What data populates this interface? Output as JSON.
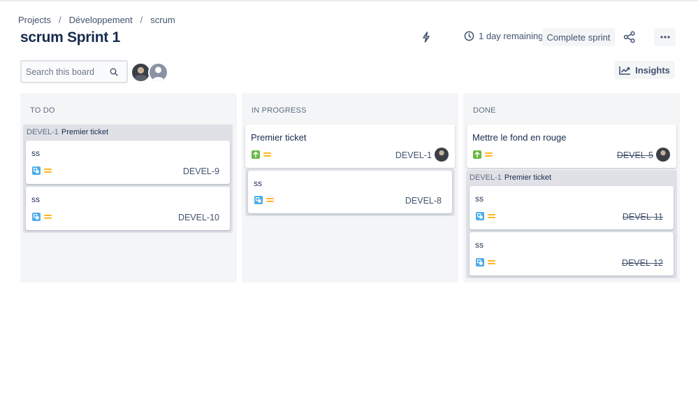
{
  "breadcrumb": {
    "items": [
      "Projects",
      "Développement",
      "scrum"
    ],
    "separator": "/"
  },
  "page": {
    "title": "scrum Sprint 1"
  },
  "header": {
    "remaining": "1 day remaining",
    "complete_label": "Complete sprint",
    "insights_label": "Insights"
  },
  "search": {
    "placeholder": "Search this board",
    "value": ""
  },
  "icons": {
    "automation": "lightning-bolt-icon",
    "clock": "clock-icon",
    "share": "share-icon",
    "more": "more-horizontal-icon",
    "search": "search-icon",
    "insights": "insights-chart-icon",
    "subtask": "subtask-icon",
    "story": "story-icon",
    "priority": "priority-medium-icon"
  },
  "colors": {
    "subtask": "#4bade8",
    "story": "#65ba43",
    "priority": "#ffab00",
    "column_bg": "#f4f5f7",
    "group_bg": "#dfe1e6"
  },
  "columns": {
    "todo": {
      "title": "TO DO",
      "group": {
        "key": "DEVEL-1",
        "summary": "Premier ticket",
        "cards": [
          {
            "title": "ss",
            "key": "DEVEL-9"
          },
          {
            "title": "ss",
            "key": "DEVEL-10"
          }
        ]
      }
    },
    "progress": {
      "title": "IN PROGRESS",
      "story": {
        "title": "Premier ticket",
        "key": "DEVEL-1"
      },
      "group": {
        "cards": [
          {
            "title": "ss",
            "key": "DEVEL-8"
          }
        ]
      }
    },
    "done": {
      "title": "DONE",
      "story": {
        "title": "Mettre le fond en rouge",
        "key": "DEVEL-5"
      },
      "group": {
        "key": "DEVEL-1",
        "summary": "Premier ticket",
        "cards": [
          {
            "title": "ss",
            "key": "DEVEL-11"
          },
          {
            "title": "ss",
            "key": "DEVEL-12"
          }
        ]
      }
    }
  }
}
